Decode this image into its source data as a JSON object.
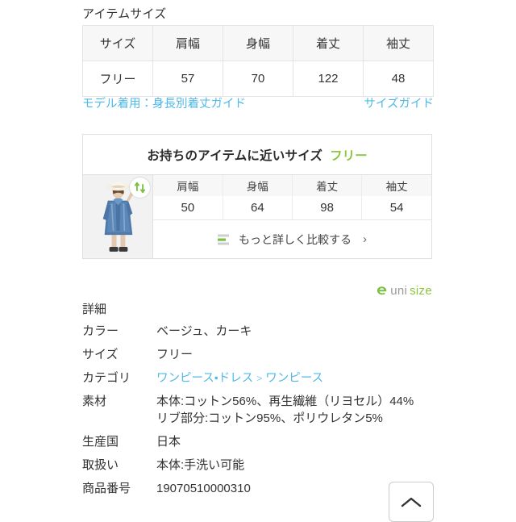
{
  "item_size": {
    "section_title": "アイテムサイズ",
    "headers": [
      "サイズ",
      "肩幅",
      "身幅",
      "着丈",
      "袖丈"
    ],
    "rows": [
      [
        "フリー",
        "57",
        "70",
        "122",
        "48"
      ]
    ],
    "model_guide_link": "モデル着用：身長別着丈ガイド",
    "size_guide_link": "サイズガイド"
  },
  "unisize": {
    "title": "お持ちのアイテムに近いサイズ",
    "size_value": "フリー",
    "thumbnail_icon": "refresh-swap-icon",
    "headers": [
      "肩幅",
      "身幅",
      "着丈",
      "袖丈"
    ],
    "values": [
      "50",
      "64",
      "98",
      "54"
    ],
    "compare_more_label": "もっと詳しく比較する",
    "compare_icon": "bar-compare-icon",
    "chevron": "›",
    "logo_first": "uni",
    "logo_second": "size",
    "accent_green": "#8cc63f"
  },
  "details": {
    "heading": "詳細",
    "rows": [
      {
        "label": "カラー",
        "value": "ベージュ、カーキ",
        "is_link": false
      },
      {
        "label": "サイズ",
        "value": "フリー",
        "is_link": false
      },
      {
        "label": "カテゴリ",
        "value": "ワンピース・ドレス > ワンピース",
        "is_link": true
      },
      {
        "label": "素材",
        "value": "本体:コットン56%、再生繊維（リヨセル）44% リブ部分:コットン95%、ポリウレタン5%",
        "is_link": false
      },
      {
        "label": "生産国",
        "value": "日本",
        "is_link": false
      },
      {
        "label": "取扱い",
        "value": "本体:手洗い可能",
        "is_link": false
      },
      {
        "label": "商品番号",
        "value": "19070510000310",
        "is_link": false
      }
    ],
    "category_parts": {
      "parent": "ワンピース・ドレス",
      "separator": ">",
      "child": "ワンピース"
    }
  },
  "scroll_top": {
    "icon": "chevron-up-icon",
    "label": "ページ上部へ戻る"
  },
  "colors": {
    "link_blue": "#4fb9e8",
    "green": "#8cc63f",
    "text": "#333333",
    "header_bg": "#f7f7f7",
    "border": "#e4e4e4"
  }
}
